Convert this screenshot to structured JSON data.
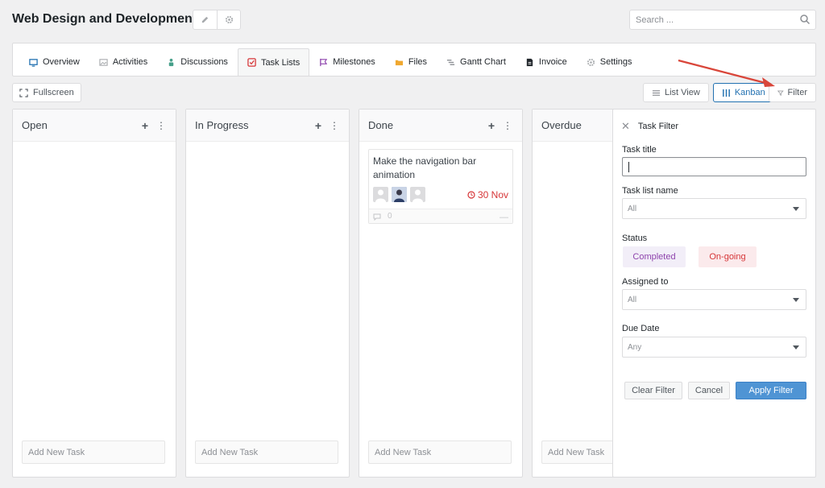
{
  "header": {
    "title": "Web Design and Development",
    "search_placeholder": "Search ..."
  },
  "tabs": [
    {
      "label": "Overview",
      "icon": "monitor-icon",
      "active": false
    },
    {
      "label": "Activities",
      "icon": "image-icon",
      "active": false
    },
    {
      "label": "Discussions",
      "icon": "users-icon",
      "active": false
    },
    {
      "label": "Task Lists",
      "icon": "checkbox-icon",
      "active": true
    },
    {
      "label": "Milestones",
      "icon": "flag-icon",
      "active": false
    },
    {
      "label": "Files",
      "icon": "folder-icon",
      "active": false
    },
    {
      "label": "Gantt Chart",
      "icon": "gantt-icon",
      "active": false
    },
    {
      "label": "Invoice",
      "icon": "invoice-icon",
      "active": false
    },
    {
      "label": "Settings",
      "icon": "gear-icon",
      "active": false
    }
  ],
  "toolbar": {
    "fullscreen_label": "Fullscreen",
    "list_view_label": "List View",
    "kanban_label": "Kanban",
    "filter_label": "Filter"
  },
  "columns": [
    {
      "title": "Open",
      "add_task_placeholder": "Add New Task"
    },
    {
      "title": "In Progress",
      "add_task_placeholder": "Add New Task"
    },
    {
      "title": "Done",
      "add_task_placeholder": "Add New Task"
    },
    {
      "title": "Overdue",
      "add_task_placeholder": "Add New Task"
    }
  ],
  "task": {
    "title": "Make the navigation bar animation",
    "due": "30 Nov",
    "comment_count": "0"
  },
  "filter": {
    "panel_title": "Task Filter",
    "task_title_label": "Task title",
    "task_title_value": "",
    "task_list_label": "Task list name",
    "task_list_value": "All",
    "status_label": "Status",
    "status_completed": "Completed",
    "status_ongoing": "On-going",
    "assigned_label": "Assigned to",
    "assigned_value": "All",
    "due_date_label": "Due Date",
    "due_date_value": "Any",
    "clear_label": "Clear Filter",
    "cancel_label": "Cancel",
    "apply_label": "Apply Filter"
  },
  "colors": {
    "accent": "#2271b1",
    "apply_button": "#4f94d4",
    "due_red": "#d63638",
    "annotation_arrow": "#d9463a"
  }
}
